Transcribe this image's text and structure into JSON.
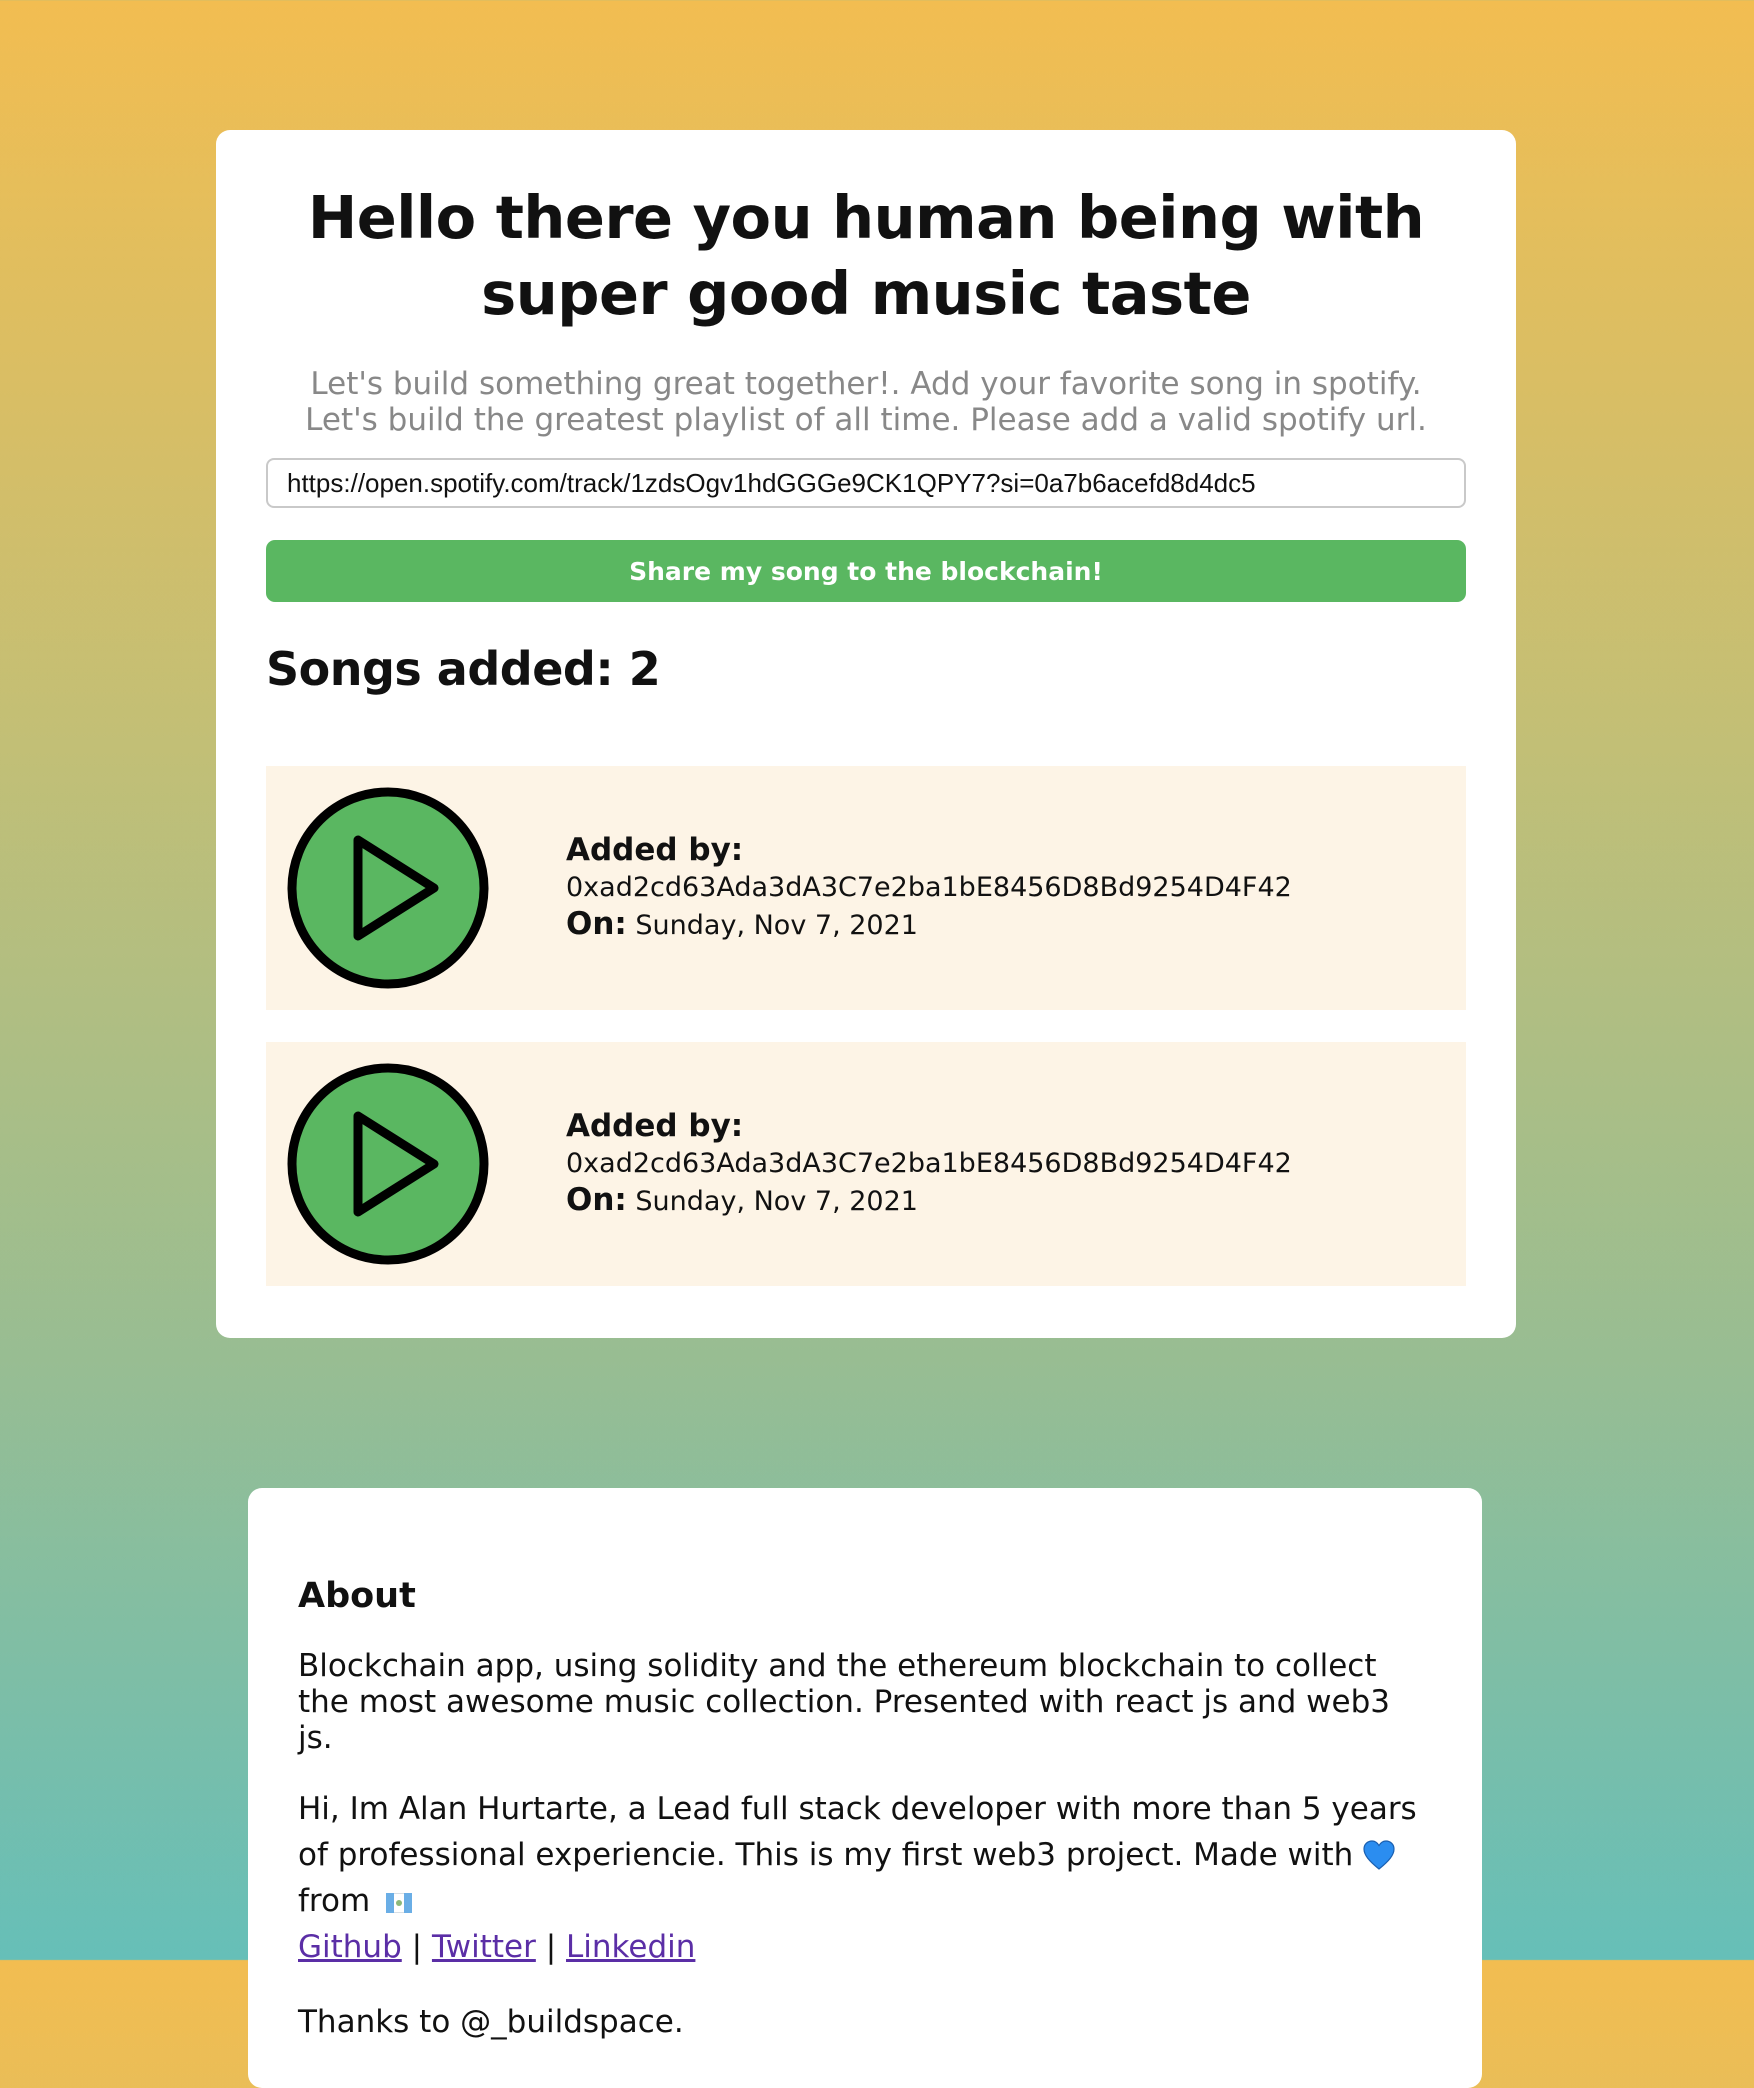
{
  "main": {
    "title": "Hello there you human being with super good music taste",
    "subtitle_line1": "Let's build something great together!. Add your favorite song in spotify.",
    "subtitle_line2": "Let's build the greatest playlist of all time. Please add a valid spotify url.",
    "url_input_value": "https://open.spotify.com/track/1zdsOgv1hdGGGe9CK1QPY7?si=0a7b6acefd8d4dc5",
    "share_button_label": "Share my song to the blockchain!",
    "songs_heading": "Songs added: 2",
    "songs": [
      {
        "added_by_label": "Added by:",
        "address": "0xad2cd63Ada3dA3C7e2ba1bE8456D8Bd9254D4F42",
        "on_label": "On:",
        "date": "Sunday, Nov 7, 2021",
        "icon": "play-circle-icon"
      },
      {
        "added_by_label": "Added by:",
        "address": "0xad2cd63Ada3dA3C7e2ba1bE8456D8Bd9254D4F42",
        "on_label": "On:",
        "date": "Sunday, Nov 7, 2021",
        "icon": "play-circle-icon"
      }
    ]
  },
  "about": {
    "heading": "About",
    "description": "Blockchain app, using solidity and the ethereum blockchain to collect the most awesome music collection. Presented with react js and web3 js.",
    "bio_prefix": "Hi, Im Alan Hurtarte, a Lead full stack developer with more than 5 years of professional experiencie. This is my first web3 project. Made with",
    "bio_from": "from",
    "heart_icon": "blue-heart-icon",
    "flag_icon": "guatemala-flag-icon",
    "links": {
      "github": "Github",
      "twitter": "Twitter",
      "linkedin": "Linkedin",
      "separator": "|"
    },
    "thanks": "Thanks to @_buildspace."
  },
  "colors": {
    "accent_green": "#5ab761",
    "song_bg": "#fdf4e6",
    "link": "#5b2ea6",
    "heart": "#2b8df0"
  }
}
